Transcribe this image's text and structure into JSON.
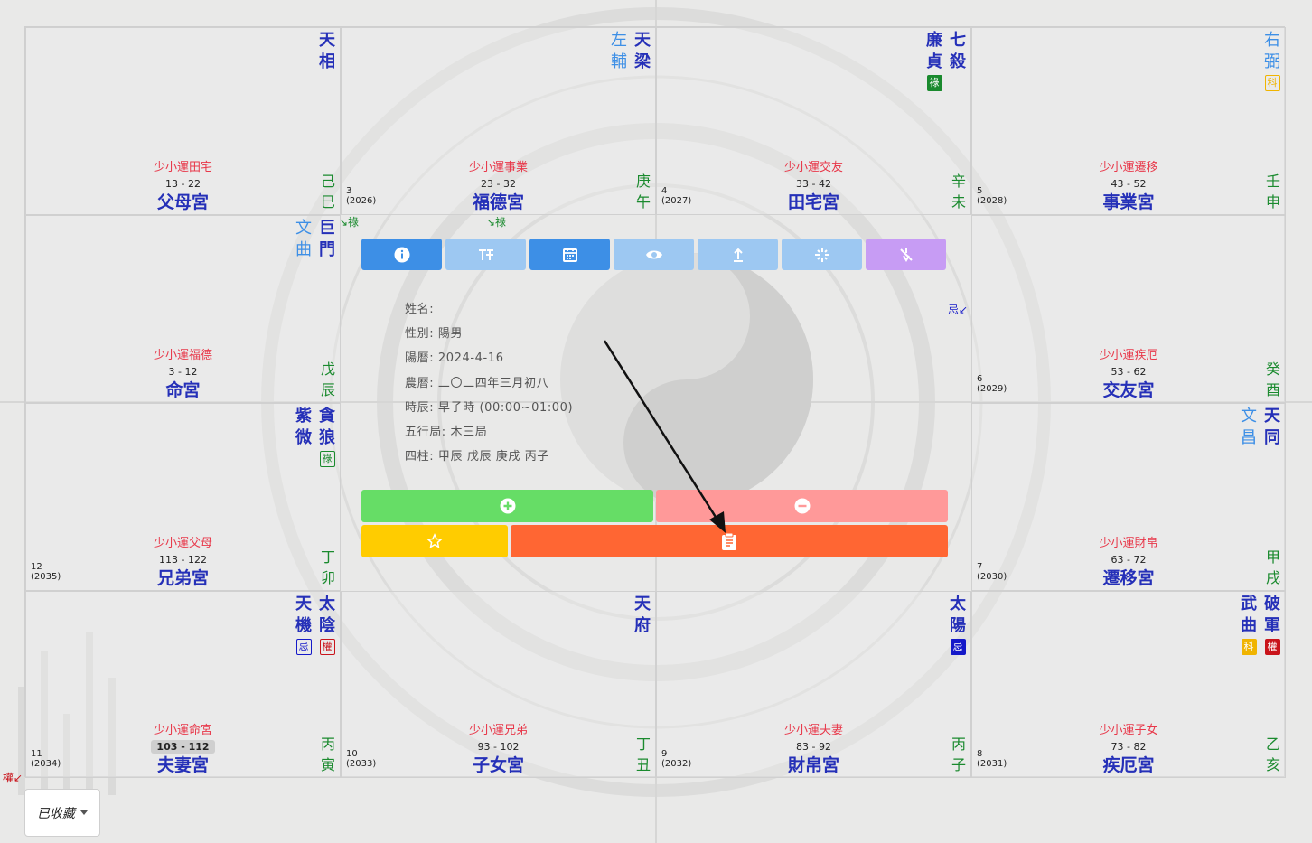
{
  "palaces": [
    {
      "id": "si",
      "stars": [
        {
          "name": "天相",
          "type": "major"
        }
      ],
      "small_luck": "少小運田宅",
      "range": "13 - 22",
      "palace": "父母宮",
      "stem": "己",
      "branch": "巳",
      "age": "",
      "year": ""
    },
    {
      "id": "wu",
      "stars": [
        {
          "name": "天梁",
          "type": "major"
        },
        {
          "name": "左輔",
          "type": "minor"
        }
      ],
      "small_luck": "少小運事業",
      "range": "23 - 32",
      "palace": "福德宮",
      "stem": "庚",
      "branch": "午",
      "age": "3",
      "year": "(2026)"
    },
    {
      "id": "wei",
      "stars": [
        {
          "name": "七殺",
          "type": "major"
        },
        {
          "name": "廉貞",
          "type": "major",
          "hua": "祿",
          "hua_style": "lu-s"
        }
      ],
      "small_luck": "少小運交友",
      "range": "33 - 42",
      "palace": "田宅宮",
      "stem": "辛",
      "branch": "未",
      "age": "4",
      "year": "(2027)"
    },
    {
      "id": "shen",
      "stars": [
        {
          "name": "右弼",
          "type": "minor",
          "hua": "科",
          "hua_style": "ke-o"
        }
      ],
      "small_luck": "少小運遷移",
      "range": "43 - 52",
      "palace": "事業宮",
      "stem": "壬",
      "branch": "申",
      "age": "5",
      "year": "(2028)"
    },
    {
      "id": "chen",
      "stars": [
        {
          "name": "巨門",
          "type": "major"
        },
        {
          "name": "文曲",
          "type": "minor"
        }
      ],
      "small_luck": "少小運福德",
      "range": "3 - 12",
      "palace": "命宮",
      "stem": "戊",
      "branch": "辰",
      "age": "",
      "year": ""
    },
    {
      "id": "you",
      "stars": [],
      "small_luck": "少小運疾厄",
      "range": "53 - 62",
      "palace": "交友宮",
      "stem": "癸",
      "branch": "酉",
      "age": "6",
      "year": "(2029)"
    },
    {
      "id": "mao",
      "stars": [
        {
          "name": "貪狼",
          "type": "major",
          "hua": "祿",
          "hua_style": "lu-o"
        },
        {
          "name": "紫微",
          "type": "major"
        }
      ],
      "small_luck": "少小運父母",
      "range": "113 - 122",
      "palace": "兄弟宮",
      "stem": "丁",
      "branch": "卯",
      "age": "12",
      "year": "(2035)"
    },
    {
      "id": "xu",
      "stars": [
        {
          "name": "天同",
          "type": "major"
        },
        {
          "name": "文昌",
          "type": "minor"
        }
      ],
      "small_luck": "少小運財帛",
      "range": "63 - 72",
      "palace": "遷移宮",
      "stem": "甲",
      "branch": "戌",
      "age": "7",
      "year": "(2030)"
    },
    {
      "id": "yin",
      "stars": [
        {
          "name": "太陰",
          "type": "major",
          "hua": "權",
          "hua_style": "quan-o"
        },
        {
          "name": "天機",
          "type": "major",
          "hua": "忌",
          "hua_style": "ji-o"
        }
      ],
      "small_luck": "少小運命宮",
      "range": "103 - 112",
      "range_hl": true,
      "palace": "夫妻宮",
      "stem": "丙",
      "branch": "寅",
      "age": "11",
      "year": "(2034)"
    },
    {
      "id": "chou",
      "stars": [
        {
          "name": "天府",
          "type": "major"
        }
      ],
      "small_luck": "少小運兄弟",
      "range": "93 - 102",
      "palace": "子女宮",
      "stem": "丁",
      "branch": "丑",
      "age": "10",
      "year": "(2033)"
    },
    {
      "id": "zi",
      "stars": [
        {
          "name": "太陽",
          "type": "major",
          "hua": "忌",
          "hua_style": "ji-s"
        }
      ],
      "small_luck": "少小運夫妻",
      "range": "83 - 92",
      "palace": "財帛宮",
      "stem": "丙",
      "branch": "子",
      "age": "9",
      "year": "(2032)"
    },
    {
      "id": "hai",
      "stars": [
        {
          "name": "破軍",
          "type": "major",
          "hua": "權",
          "hua_style": "quan-s"
        },
        {
          "name": "武曲",
          "type": "major",
          "hua": "科",
          "hua_style": "ke-s"
        }
      ],
      "small_luck": "少小運子女",
      "range": "73 - 82",
      "palace": "疾厄宮",
      "stem": "乙",
      "branch": "亥",
      "age": "8",
      "year": "(2031)"
    }
  ],
  "info": {
    "name": "姓名:",
    "gender": "性別: 陽男",
    "solar": "陽曆: 2024-4-16",
    "lunar": "農曆: 二〇二四年三月初八",
    "hour": "時辰: 早子時 (00:00~01:00)",
    "element": "五行局: 木三局",
    "pillars": "四柱: 甲辰 戊辰 庚戌 丙子"
  },
  "toolbar": [
    {
      "name": "info-button",
      "icon": "info-icon",
      "color": "#3d8fe6"
    },
    {
      "name": "typography-button",
      "icon": "text-style-icon",
      "color": "#9dc8f2"
    },
    {
      "name": "calendar-button",
      "icon": "calendar-icon",
      "color": "#3d8fe6"
    },
    {
      "name": "eye-button",
      "icon": "eye-icon",
      "color": "#9dc8f2"
    },
    {
      "name": "upload-button",
      "icon": "upload-icon",
      "color": "#9dc8f2"
    },
    {
      "name": "spark-button",
      "icon": "spark-icon",
      "color": "#9dc8f2"
    },
    {
      "name": "no-flow-button",
      "icon": "no-flow-icon",
      "color": "#c79cf4"
    }
  ],
  "flow_marks": {
    "lu_1": "↘祿",
    "lu_2": "↘祿",
    "ji": "忌↙",
    "quan": "權↙"
  },
  "saved_label": "已收藏",
  "colors": {
    "add": "#66dd66",
    "remove": "#ff9999",
    "favorite": "#ffcc00",
    "notes": "#ff6633"
  }
}
